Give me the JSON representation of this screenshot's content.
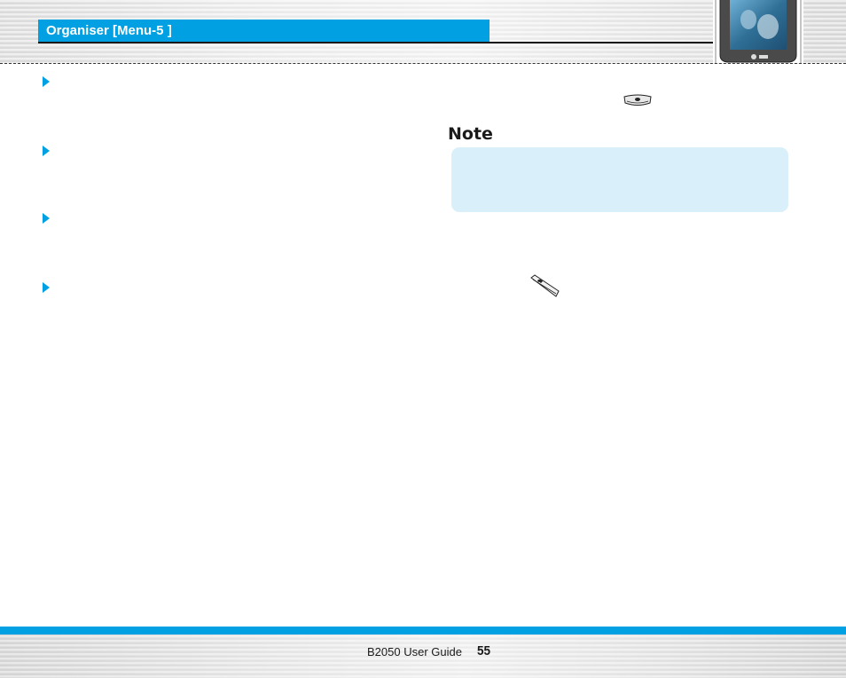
{
  "header": {
    "section_title": "Organiser [Menu-5 ]"
  },
  "note": {
    "heading": "Note"
  },
  "icons": {
    "bullet": "triangle-bullet-icon",
    "ok_key": "ok-key-icon",
    "send_key": "send-key-icon",
    "phone": "phone-illustration"
  },
  "footer": {
    "guide_label": "B2050 User Guide",
    "page_number": "55"
  },
  "colors": {
    "accent": "#00a0e3",
    "note_background": "#d9f0fa",
    "text": "#1a1a1a"
  }
}
